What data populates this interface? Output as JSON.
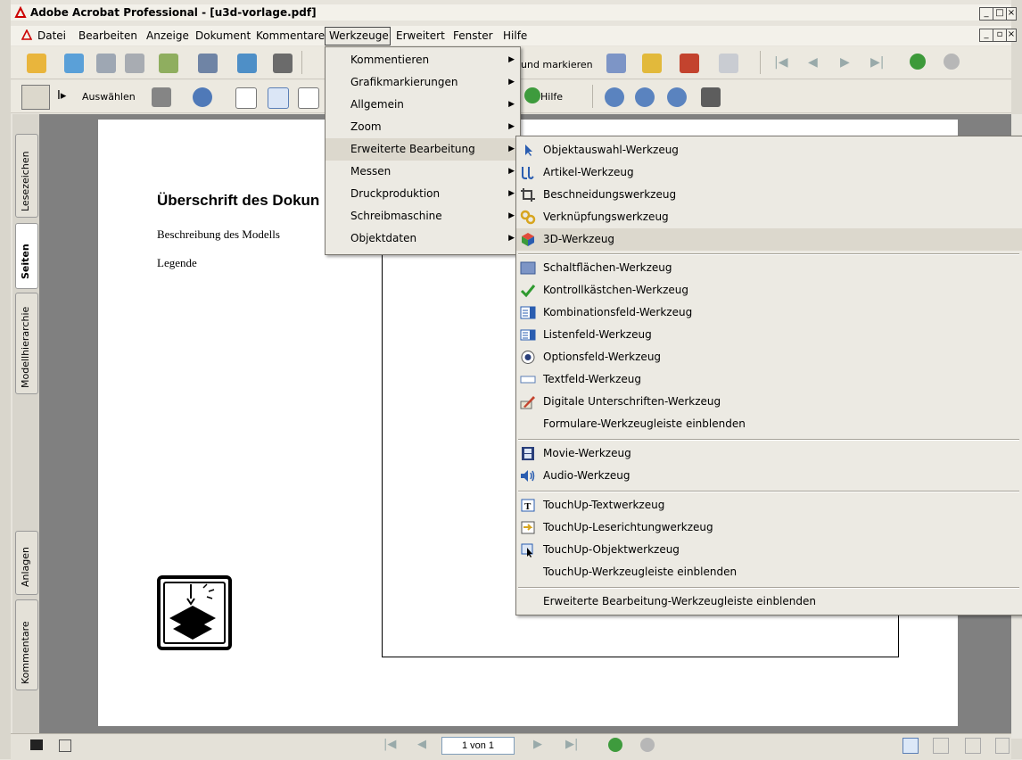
{
  "window": {
    "title": "Adobe Acrobat Professional - [u3d-vorlage.pdf]"
  },
  "menubar": [
    "Datei",
    "Bearbeiten",
    "Anzeige",
    "Dokument",
    "Kommentare",
    "Werkzeuge",
    "Erweitert",
    "Fenster",
    "Hilfe"
  ],
  "toolbar": {
    "select_label": "Auswählen",
    "help_label": "Hilfe",
    "mark_label": "und markieren"
  },
  "nav_tabs": [
    "Lesezeichen",
    "Seiten",
    "Modellhierarchie",
    "Anlagen",
    "Kommentare"
  ],
  "document": {
    "heading": "Überschrift des Dokun",
    "description": "Beschreibung des Modells",
    "legend": "Legende"
  },
  "status": {
    "page": "1 von 1"
  },
  "werkzeuge_menu": [
    "Kommentieren",
    "Grafikmarkierungen",
    "Allgemein",
    "Zoom",
    "Erweiterte Bearbeitung",
    "Messen",
    "Druckproduktion",
    "Schreibmaschine",
    "Objektdaten"
  ],
  "erweiterte_bearbeitung_menu": [
    {
      "label": "Objektauswahl-Werkzeug",
      "icon": "arrow-select-icon"
    },
    {
      "label": "Artikel-Werkzeug",
      "icon": "article-icon"
    },
    {
      "label": "Beschneidungswerkzeug",
      "icon": "crop-icon"
    },
    {
      "label": "Verknüpfungswerkzeug",
      "icon": "link-icon"
    },
    {
      "label": "3D-Werkzeug",
      "icon": "cube-3d-icon"
    },
    {
      "label": "Schaltflächen-Werkzeug",
      "icon": "button-icon"
    },
    {
      "label": "Kontrollkästchen-Werkzeug",
      "icon": "checkbox-icon"
    },
    {
      "label": "Kombinationsfeld-Werkzeug",
      "icon": "combobox-icon"
    },
    {
      "label": "Listenfeld-Werkzeug",
      "icon": "listbox-icon"
    },
    {
      "label": "Optionsfeld-Werkzeug",
      "icon": "radio-icon"
    },
    {
      "label": "Textfeld-Werkzeug",
      "icon": "textfield-icon"
    },
    {
      "label": "Digitale Unterschriften-Werkzeug",
      "icon": "signature-icon"
    },
    {
      "label": "Formulare-Werkzeugleiste einblenden",
      "icon": ""
    },
    {
      "label": "Movie-Werkzeug",
      "icon": "movie-icon"
    },
    {
      "label": "Audio-Werkzeug",
      "icon": "audio-icon"
    },
    {
      "label": "TouchUp-Textwerkzeug",
      "icon": "touchup-text-icon"
    },
    {
      "label": "TouchUp-Leserichtungwerkzeug",
      "icon": "reading-order-icon"
    },
    {
      "label": "TouchUp-Objektwerkzeug",
      "icon": "touchup-object-icon"
    },
    {
      "label": "TouchUp-Werkzeugleiste einblenden",
      "icon": ""
    },
    {
      "label": "Erweiterte Bearbeitung-Werkzeugleiste einblenden",
      "icon": ""
    }
  ]
}
